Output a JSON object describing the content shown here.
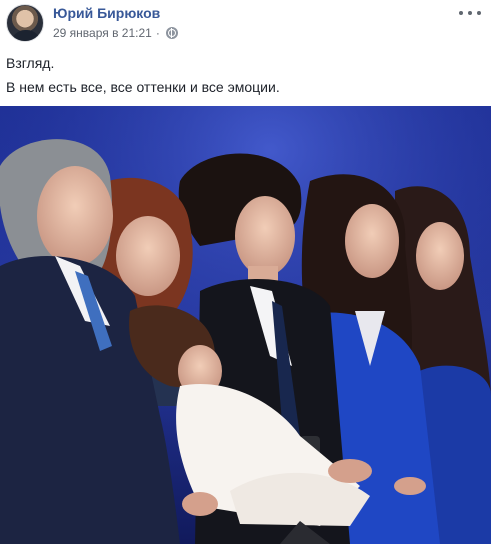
{
  "post": {
    "author": "Юрий Бирюков",
    "timestamp": "29 января в 21:21",
    "separator": "·",
    "privacy_icon": "globe-icon",
    "more_icon": "more-horizontal-icon",
    "text_lines": [
      "Взгляд.",
      "В нем есть все, все оттенки и все эмоции."
    ],
    "photo_icon": "photo",
    "colors": {
      "author_link": "#385898",
      "meta": "#616770",
      "body_text": "#1d2129"
    }
  }
}
